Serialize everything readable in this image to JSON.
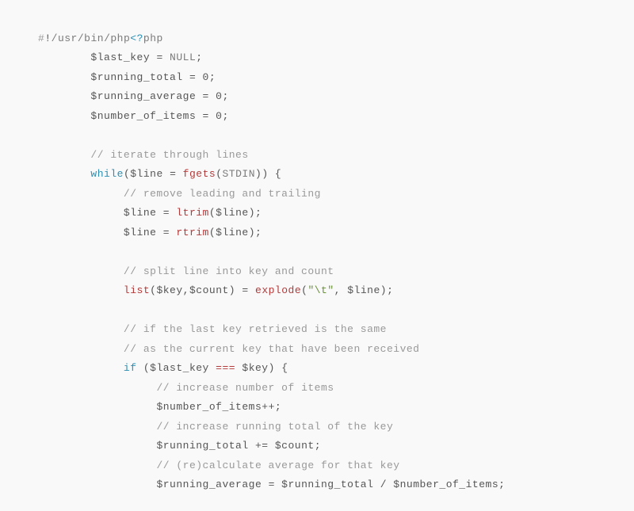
{
  "l1": {
    "a": "#",
    "b": "!",
    "c": "/",
    "d": "usr",
    "e": "/",
    "f": "bin",
    "g": "/",
    "h": "php",
    "i": "<?",
    "j": "php"
  },
  "l2": {
    "a": "$last_key",
    "b": " = ",
    "c": "NULL",
    "d": ";"
  },
  "l3": {
    "a": "$running_total",
    "b": " = ",
    "c": "0",
    "d": ";"
  },
  "l4": {
    "a": "$running_average",
    "b": " = ",
    "c": "0",
    "d": ";"
  },
  "l5": {
    "a": "$number_of_items",
    "b": " = ",
    "c": "0",
    "d": ";"
  },
  "l6": "",
  "l7": {
    "a": "// iterate through lines"
  },
  "l8": {
    "a": "while",
    "b": "(",
    "c": "$line",
    "d": " = ",
    "e": "fgets",
    "f": "(",
    "g": "STDIN",
    "h": "))",
    "i": " {"
  },
  "l9": {
    "a": "// remove leading and trailing"
  },
  "l10": {
    "a": "$line",
    "b": " = ",
    "c": "ltrim",
    "d": "(",
    "e": "$line",
    "f": ");"
  },
  "l11": {
    "a": "$line",
    "b": " = ",
    "c": "rtrim",
    "d": "(",
    "e": "$line",
    "f": ");"
  },
  "l12": "",
  "l13": {
    "a": "// split line into key and count"
  },
  "l14": {
    "a": "list",
    "b": "(",
    "c": "$key",
    "d": ",",
    "e": "$count",
    "f": ")",
    "g": " = ",
    "h": "explode",
    "i": "(",
    "j": "\"\\t\"",
    "k": ", ",
    "l": "$line",
    "m": ");"
  },
  "l15": "",
  "l16": {
    "a": "// if the last key retrieved is the same"
  },
  "l17": {
    "a": "// as the current key that have been received"
  },
  "l18": {
    "a": "if",
    "b": " (",
    "c": "$last_key",
    "d": " ",
    "e": "===",
    "f": " ",
    "g": "$key",
    "h": ") {"
  },
  "l19": {
    "a": "// increase number of items"
  },
  "l20": {
    "a": "$number_of_items",
    "b": "++;"
  },
  "l21": {
    "a": "// increase running total of the key"
  },
  "l22": {
    "a": "$running_total",
    "b": " += ",
    "c": "$count",
    "d": ";"
  },
  "l23": {
    "a": "// (re)calculate average for that key"
  },
  "l24": {
    "a": "$running_average",
    "b": " = ",
    "c": "$running_total",
    "d": " / ",
    "e": "$number_of_items",
    "f": ";"
  }
}
